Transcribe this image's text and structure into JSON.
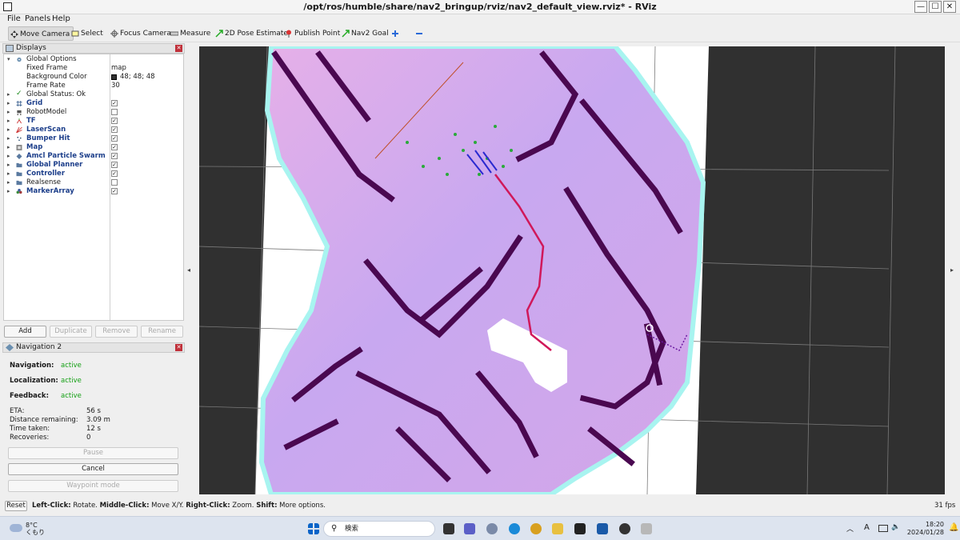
{
  "window": {
    "title": "/opt/ros/humble/share/nav2_bringup/rviz/nav2_default_view.rviz* - RViz",
    "minimize": "—",
    "maximize": "☐",
    "close": "✕"
  },
  "menu": [
    "File",
    "Panels",
    "Help"
  ],
  "toolbar": {
    "tools": [
      {
        "label": "Move Camera",
        "icon": "move-camera-icon",
        "active": true
      },
      {
        "label": "Select",
        "icon": "select-icon"
      },
      {
        "label": "Focus Camera",
        "icon": "focus-camera-icon"
      },
      {
        "label": "Measure",
        "icon": "measure-icon"
      },
      {
        "label": "2D Pose Estimate",
        "icon": "pose-estimate-arrow-icon"
      },
      {
        "label": "Publish Point",
        "icon": "publish-point-pin-icon"
      },
      {
        "label": "Nav2 Goal",
        "icon": "nav2-goal-arrow-icon"
      }
    ],
    "extra_icons": [
      "add-tool-plus-icon",
      "remove-tool-minus-icon"
    ]
  },
  "displays_panel": {
    "title": "Displays",
    "global_options": {
      "label": "Global Options",
      "fixed_frame_label": "Fixed Frame",
      "fixed_frame_value": "map",
      "background_color_label": "Background Color",
      "background_color_value": "48; 48; 48",
      "background_color_hex": "#303030",
      "frame_rate_label": "Frame Rate",
      "frame_rate_value": "30"
    },
    "global_status": "Global Status: Ok",
    "items": [
      {
        "label": "Grid",
        "icon": "grid-icon",
        "checked": true,
        "bold": true
      },
      {
        "label": "RobotModel",
        "icon": "robot-model-icon",
        "checked": false,
        "bold": false
      },
      {
        "label": "TF",
        "icon": "tf-icon",
        "checked": true,
        "bold": true
      },
      {
        "label": "LaserScan",
        "icon": "laserscan-icon",
        "checked": true,
        "bold": true
      },
      {
        "label": "Bumper Hit",
        "icon": "bumper-hit-icon",
        "checked": true,
        "bold": true
      },
      {
        "label": "Map",
        "icon": "map-icon",
        "checked": true,
        "bold": true
      },
      {
        "label": "Amcl Particle Swarm",
        "icon": "particle-swarm-icon",
        "checked": true,
        "bold": true
      },
      {
        "label": "Global Planner",
        "icon": "folder-icon",
        "checked": true,
        "bold": true
      },
      {
        "label": "Controller",
        "icon": "folder-icon",
        "checked": true,
        "bold": true
      },
      {
        "label": "Realsense",
        "icon": "folder-icon",
        "checked": false,
        "bold": false
      },
      {
        "label": "MarkerArray",
        "icon": "marker-array-icon",
        "checked": true,
        "bold": true
      }
    ],
    "buttons": {
      "add": "Add",
      "duplicate": "Duplicate",
      "remove": "Remove",
      "rename": "Rename"
    }
  },
  "navigation_panel": {
    "title": "Navigation 2",
    "navigation_label": "Navigation:",
    "navigation_value": "active",
    "localization_label": "Localization:",
    "localization_value": "active",
    "feedback_label": "Feedback:",
    "feedback_value": "active",
    "eta_label": "ETA:",
    "eta_value": "56 s",
    "distance_label": "Distance remaining:",
    "distance_value": "3.09 m",
    "time_label": "Time taken:",
    "time_value": "12 s",
    "recoveries_label": "Recoveries:",
    "recoveries_value": "0",
    "pause_button": "Pause",
    "cancel_button": "Cancel",
    "waypoint_button": "Waypoint mode"
  },
  "status": {
    "reset": "Reset",
    "hint_left_click": "Left-Click:",
    "hint_left_text": " Rotate. ",
    "hint_middle_click": "Middle-Click:",
    "hint_middle_text": " Move X/Y. ",
    "hint_right_click": "Right-Click:",
    "hint_right_text": " Zoom. ",
    "hint_shift": "Shift:",
    "hint_shift_text": " More options.",
    "fps": "31 fps"
  },
  "taskbar": {
    "weather_temp": "8°C",
    "weather_cond": "くもり",
    "search_placeholder": "検索",
    "time": "18:20",
    "date": "2024/01/28",
    "ime": "A",
    "colors": {
      "accent": "#0a64c8",
      "taskbar": "#dde4ef"
    }
  },
  "colors": {
    "nav_active": "#14a014",
    "display_item_bold": "#1c3e8a",
    "viewport_bg": "#303030",
    "costmap_pink": "#e0a8e0",
    "costmap_purple": "#b0a0f0",
    "costmap_cyan": "#a8f4f0",
    "obstacle": "#4a0850",
    "path": "#d0185a"
  }
}
